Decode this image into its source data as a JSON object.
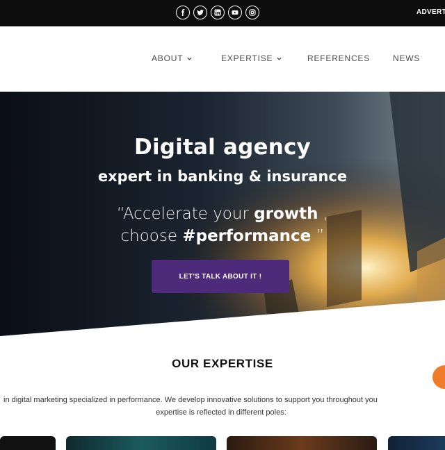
{
  "topbar": {
    "socials": [
      {
        "icon": "facebook-icon"
      },
      {
        "icon": "twitter-icon"
      },
      {
        "icon": "linkedin-icon"
      },
      {
        "icon": "youtube-icon"
      },
      {
        "icon": "instagram-icon"
      }
    ],
    "advert_label": "ADVERT"
  },
  "nav": {
    "about": "ABOUT",
    "expertise": "EXPERTISE",
    "references": "REFERENCES",
    "news": "NEWS"
  },
  "hero": {
    "title": "Digital agency",
    "subtitle": "expert in banking & insurance",
    "quote_line1_pre": "“Accelerate your ",
    "quote_line1_bold": "growth",
    "quote_line1_post": " ,",
    "quote_line2_pre": "choose ",
    "quote_line2_bold": "#performance",
    "quote_line2_post": " ”",
    "cta_label": "LET'S TALK ABOUT IT !"
  },
  "expertise": {
    "title": "OUR EXPERTISE",
    "text_line1": "in digital marketing specialized in performance. We develop innovative solutions to support you throughout you",
    "text_line2": "expertise is reflected in different poles:"
  },
  "colors": {
    "cta": "#4e2a7a",
    "topbar": "#0d0d0d",
    "floating_button": "#f07c2a"
  }
}
